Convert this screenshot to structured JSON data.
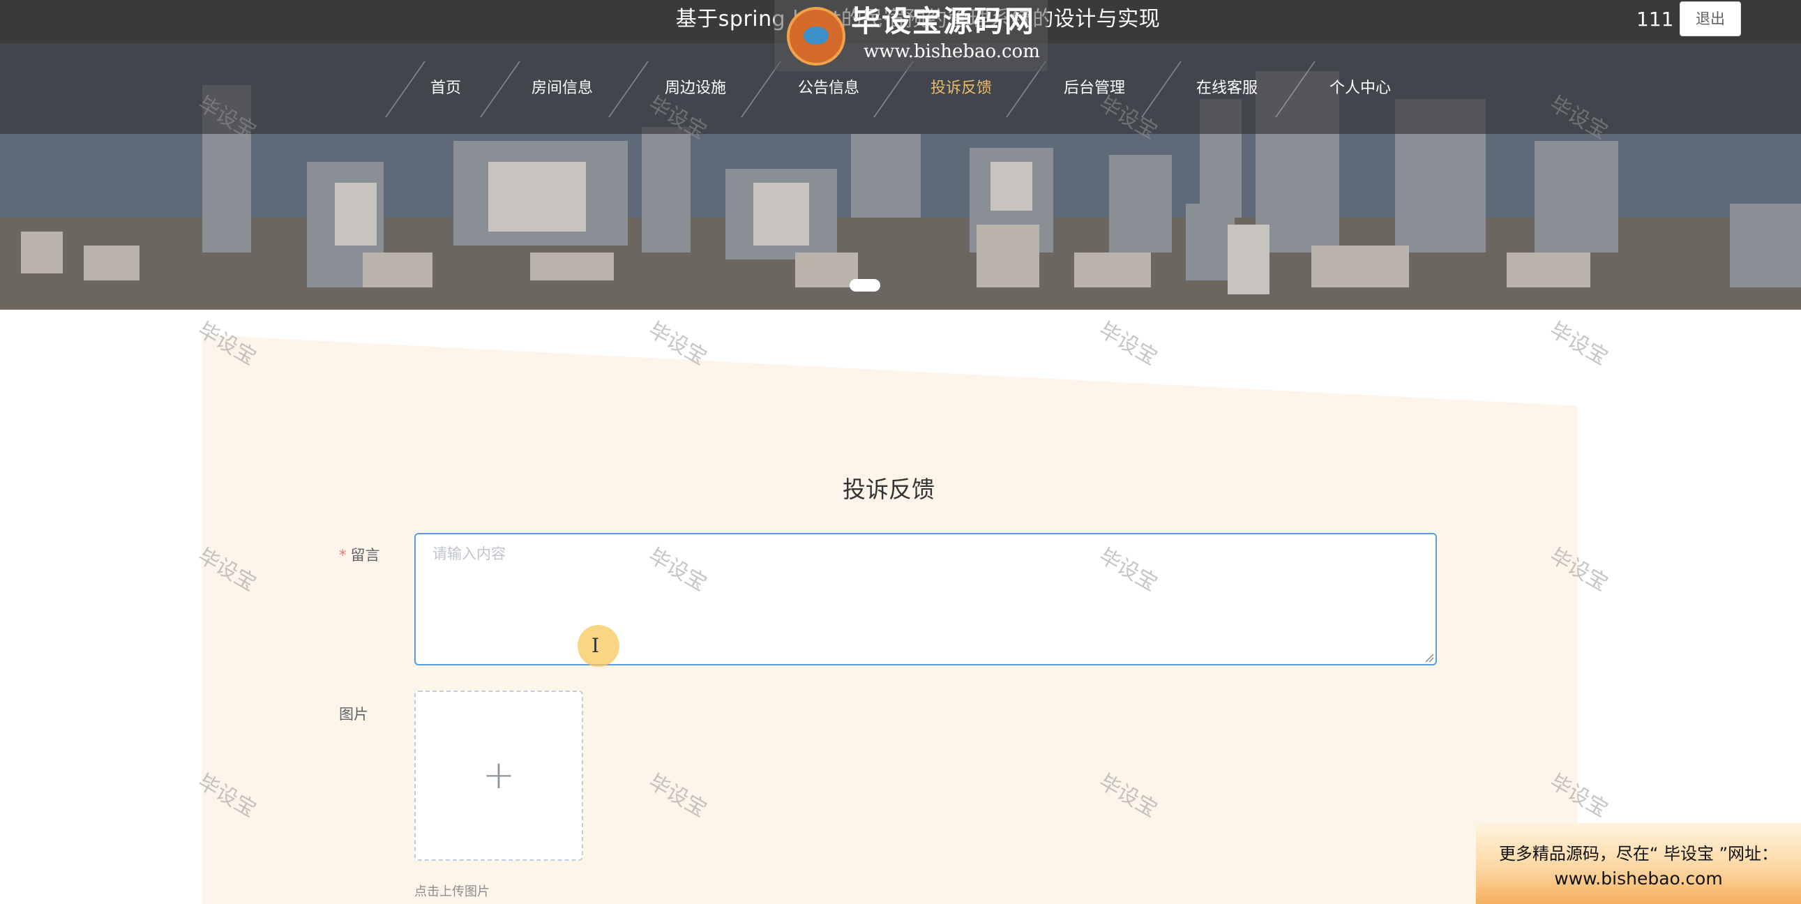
{
  "header": {
    "site_title": "基于spring boot的民宿预约管理系统的设计与实现",
    "username": "111",
    "logout_label": "退出"
  },
  "watermark_logo": {
    "title": "毕设宝源码网",
    "url": "www.bishebao.com"
  },
  "nav": {
    "items": [
      {
        "label": "首页",
        "active": false
      },
      {
        "label": "房间信息",
        "active": false
      },
      {
        "label": "周边设施",
        "active": false
      },
      {
        "label": "公告信息",
        "active": false
      },
      {
        "label": "投诉反馈",
        "active": true
      },
      {
        "label": "后台管理",
        "active": false
      },
      {
        "label": "在线客服",
        "active": false
      },
      {
        "label": "个人中心",
        "active": false
      }
    ]
  },
  "form": {
    "title": "投诉反馈",
    "message_required_mark": "*",
    "message_label": "留言",
    "message_placeholder": "请输入内容",
    "image_label": "图片",
    "upload_plus": "+",
    "upload_tip": "点击上传图片"
  },
  "watermark_text": "毕设宝",
  "promo": {
    "line1": "更多精品源码，尽在“ 毕设宝 ”网址：",
    "line2": "www.bishebao.com"
  },
  "colors": {
    "topbar": "#3a3a3a",
    "nav_active": "#e9b96e",
    "panel": "#fdf5ea",
    "input_focus_border": "#5b9bd5",
    "required": "#f56c6c"
  }
}
